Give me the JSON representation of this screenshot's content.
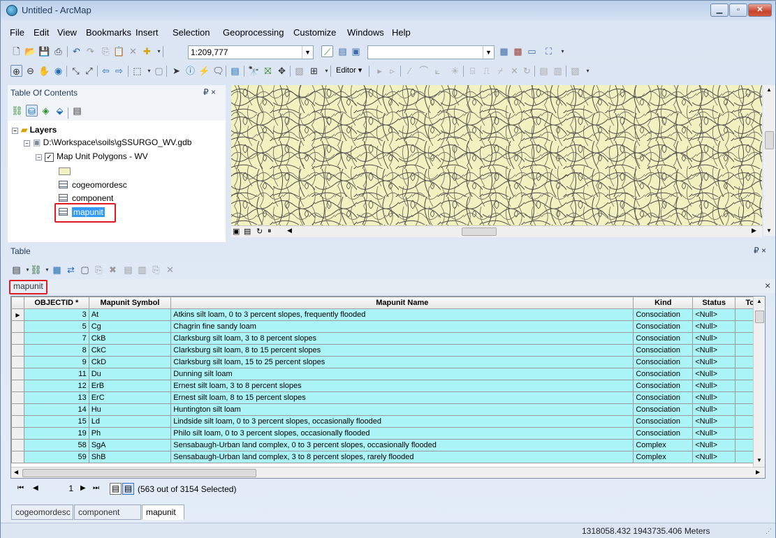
{
  "window": {
    "title": "Untitled - ArcMap"
  },
  "menu": [
    "File",
    "Edit",
    "View",
    "Bookmarks",
    "Insert",
    "Selection",
    "Geoprocessing",
    "Customize",
    "Windows",
    "Help"
  ],
  "toolbar": {
    "scale": "1:209,777",
    "editor_label": "Editor ▾"
  },
  "toc": {
    "title": "Table Of Contents",
    "pin": "₽ ×",
    "layers_label": "Layers",
    "workspace": "D:\\Workspace\\soils\\gSSURGO_WV.gdb",
    "layer": "Map Unit Polygons - WV",
    "tables": [
      "cogeomordesc",
      "component",
      "mapunit"
    ],
    "selected_table": "mapunit"
  },
  "table_panel": {
    "title": "Table",
    "pin": "₽ ×",
    "tab_label": "mapunit",
    "close": "×",
    "columns": [
      "OBJECTID *",
      "Mapunit Symbol",
      "Mapunit Name",
      "Kind",
      "Status",
      "Tc"
    ],
    "rows": [
      [
        "3",
        "At",
        "Atkins silt loam, 0 to 3 percent slopes, frequently flooded",
        "Consociation",
        "<Null>"
      ],
      [
        "5",
        "Cg",
        "Chagrin fine sandy loam",
        "Consociation",
        "<Null>"
      ],
      [
        "7",
        "CkB",
        "Clarksburg silt loam, 3 to 8 percent slopes",
        "Consociation",
        "<Null>"
      ],
      [
        "8",
        "CkC",
        "Clarksburg silt loam, 8 to 15 percent slopes",
        "Consociation",
        "<Null>"
      ],
      [
        "9",
        "CkD",
        "Clarksburg silt loam, 15 to 25 percent slopes",
        "Consociation",
        "<Null>"
      ],
      [
        "11",
        "Du",
        "Dunning silt loam",
        "Consociation",
        "<Null>"
      ],
      [
        "12",
        "ErB",
        "Ernest silt loam, 3 to 8 percent slopes",
        "Consociation",
        "<Null>"
      ],
      [
        "13",
        "ErC",
        "Ernest silt loam, 8 to 15 percent slopes",
        "Consociation",
        "<Null>"
      ],
      [
        "14",
        "Hu",
        "Huntington silt loam",
        "Consociation",
        "<Null>"
      ],
      [
        "15",
        "Ld",
        "Lindside silt loam, 0 to 3 percent slopes, occasionally flooded",
        "Consociation",
        "<Null>"
      ],
      [
        "19",
        "Ph",
        "Philo silt loam, 0 to 3 percent slopes, occasionally flooded",
        "Consociation",
        "<Null>"
      ],
      [
        "58",
        "SgA",
        "Sensabaugh-Urban land complex, 0 to 3 percent slopes, occasionally flooded",
        "Complex",
        "<Null>"
      ],
      [
        "59",
        "ShB",
        "Sensabaugh-Urban land complex, 3 to 8 percent slopes, rarely flooded",
        "Complex",
        "<Null>"
      ]
    ],
    "record_number": "1",
    "selection_text": "(563 out of 3154 Selected)",
    "bottom_tabs": [
      "cogeomordesc",
      "component",
      "mapunit"
    ]
  },
  "status": {
    "coordinates": "1318058.432  1943735.406 Meters"
  },
  "colors": {
    "row_highlight": "#aaf3f6",
    "map_fill": "#f2f2c0",
    "selection": "#3399ff",
    "callout": "#e01b24"
  }
}
